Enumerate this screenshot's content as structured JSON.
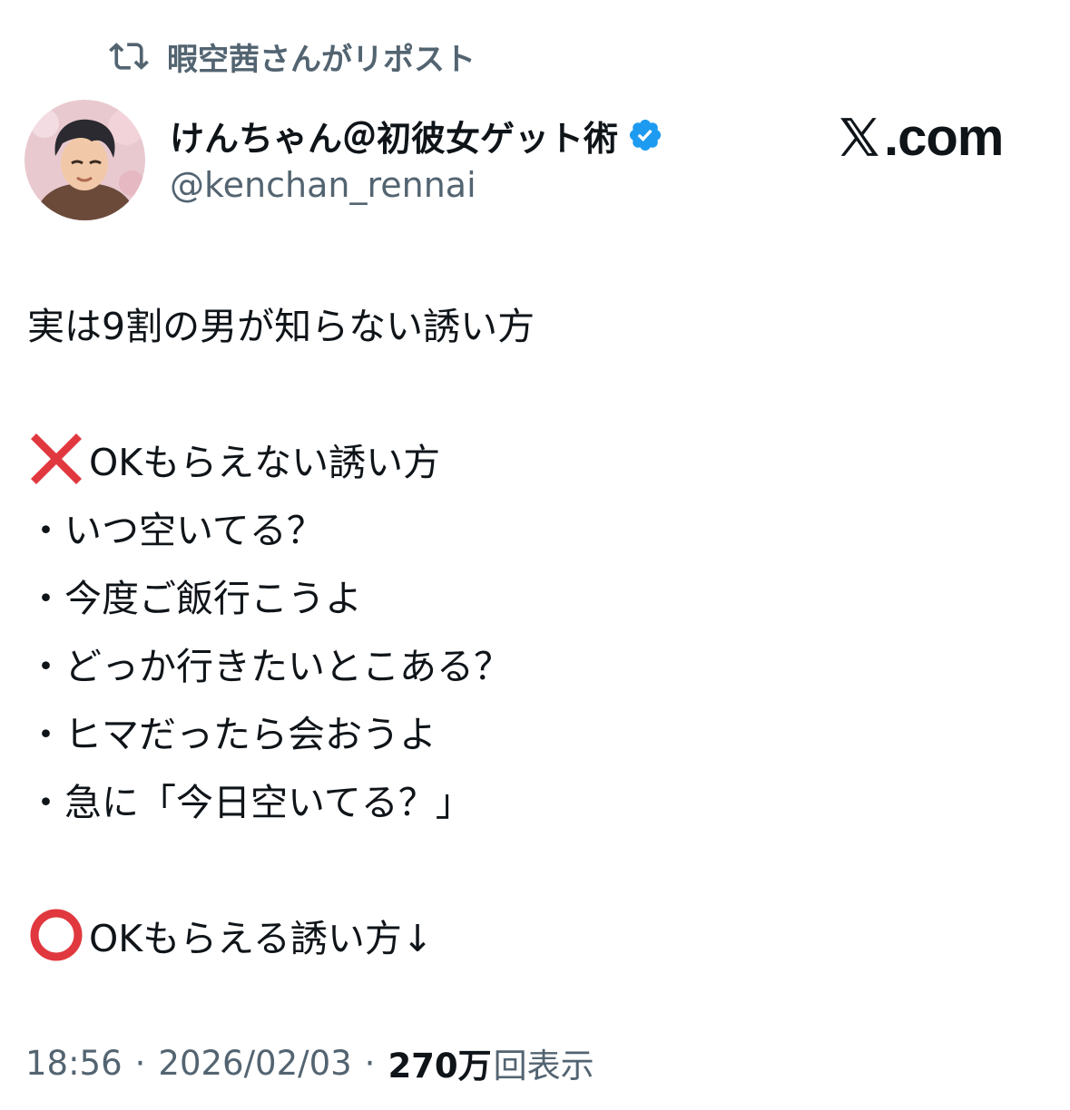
{
  "repost": {
    "icon": "repost-icon",
    "text": "暇空茜さんがリポスト"
  },
  "author": {
    "avatar_icon": "avatar",
    "name": "けんちゃん＠初彼女ゲット術",
    "verified_icon": "verified-badge-icon",
    "handle": "@kenchan_rennai"
  },
  "brand": {
    "text": ".com",
    "icon": "x-logo-icon"
  },
  "tweet": {
    "lines": [
      "実は9割の男が知らない誘い方",
      "",
      "OKもらえない誘い方",
      "・いつ空いてる？",
      "・今度ご飯行こうよ",
      "・どっか行きたいとこある？",
      "・ヒマだったら会おうよ",
      "・急に「今日空いてる？」",
      "",
      "OKもらえる誘い方↓"
    ],
    "emoji": {
      "cross": "cross-mark-icon",
      "circle": "red-circle-icon"
    }
  },
  "meta": {
    "time": "18:56",
    "date": "2026/02/03",
    "separator": "·",
    "views_count": "270万",
    "views_label": "回表示"
  },
  "colors": {
    "text": "#0f1419",
    "secondary": "#536471",
    "verified": "#1d9bf0",
    "cross": "#e0383e"
  }
}
